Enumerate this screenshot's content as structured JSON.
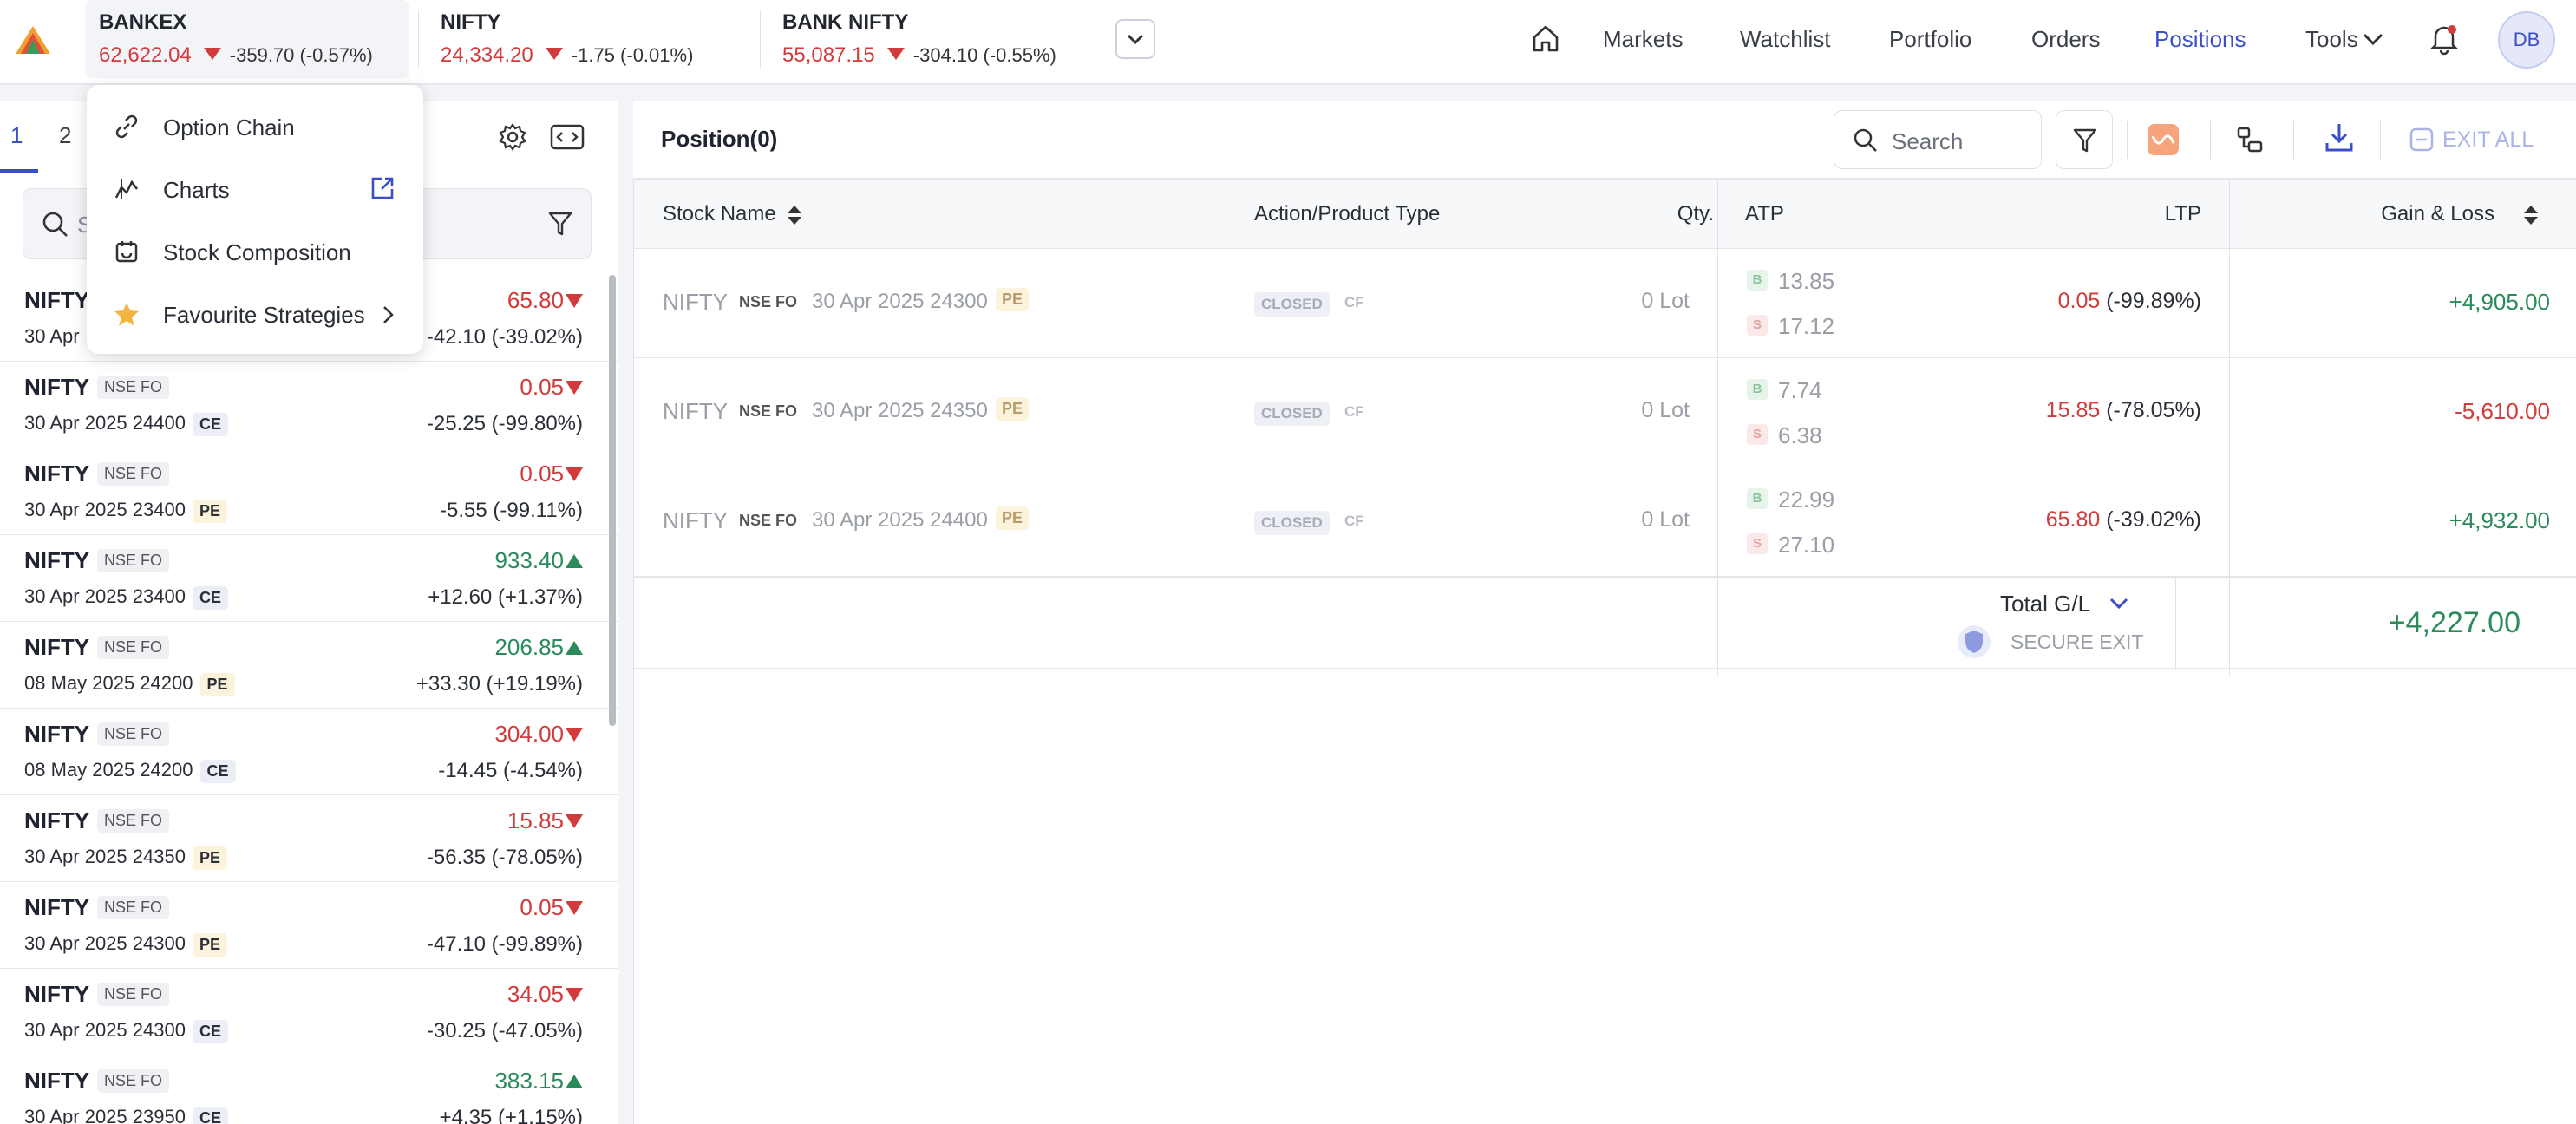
{
  "header": {
    "indices": [
      {
        "name": "BANKEX",
        "price": "62,622.04",
        "change": "-359.70 (-0.57%)"
      },
      {
        "name": "NIFTY",
        "price": "24,334.20",
        "change": "-1.75 (-0.01%)"
      },
      {
        "name": "BANK NIFTY",
        "price": "55,087.15",
        "change": "-304.10 (-0.55%)"
      }
    ],
    "nav": [
      "Markets",
      "Watchlist",
      "Portfolio",
      "Orders",
      "Positions",
      "Tools"
    ],
    "active_nav": "Positions",
    "avatar": "DB"
  },
  "watchlist": {
    "tabs": [
      "1",
      "2"
    ],
    "search_placeholder": "S",
    "rows": [
      {
        "symbol": "NIFTY",
        "exchange": "NSE FO",
        "desc": "30 Apr",
        "type": "",
        "ltp": "65.80",
        "dir": "down",
        "change": "-42.10 (-39.02%)"
      },
      {
        "symbol": "NIFTY",
        "exchange": "NSE FO",
        "desc": "30 Apr 2025 24400",
        "type": "CE",
        "ltp": "0.05",
        "dir": "down",
        "change": "-25.25 (-99.80%)"
      },
      {
        "symbol": "NIFTY",
        "exchange": "NSE FO",
        "desc": "30 Apr 2025 23400",
        "type": "PE",
        "ltp": "0.05",
        "dir": "down",
        "change": "-5.55 (-99.11%)"
      },
      {
        "symbol": "NIFTY",
        "exchange": "NSE FO",
        "desc": "30 Apr 2025 23400",
        "type": "CE",
        "ltp": "933.40",
        "dir": "up",
        "change": "+12.60 (+1.37%)"
      },
      {
        "symbol": "NIFTY",
        "exchange": "NSE FO",
        "desc": "08 May 2025 24200",
        "type": "PE",
        "ltp": "206.85",
        "dir": "up",
        "change": "+33.30 (+19.19%)"
      },
      {
        "symbol": "NIFTY",
        "exchange": "NSE FO",
        "desc": "08 May 2025 24200",
        "type": "CE",
        "ltp": "304.00",
        "dir": "down",
        "change": "-14.45 (-4.54%)"
      },
      {
        "symbol": "NIFTY",
        "exchange": "NSE FO",
        "desc": "30 Apr 2025 24350",
        "type": "PE",
        "ltp": "15.85",
        "dir": "down",
        "change": "-56.35 (-78.05%)"
      },
      {
        "symbol": "NIFTY",
        "exchange": "NSE FO",
        "desc": "30 Apr 2025 24300",
        "type": "PE",
        "ltp": "0.05",
        "dir": "down",
        "change": "-47.10 (-99.89%)"
      },
      {
        "symbol": "NIFTY",
        "exchange": "NSE FO",
        "desc": "30 Apr 2025 24300",
        "type": "CE",
        "ltp": "34.05",
        "dir": "down",
        "change": "-30.25 (-47.05%)"
      },
      {
        "symbol": "NIFTY",
        "exchange": "NSE FO",
        "desc": "30 Apr 2025 23950",
        "type": "CE",
        "ltp": "383.15",
        "dir": "up",
        "change": "+4.35 (+1.15%)"
      }
    ]
  },
  "menu": {
    "items": [
      {
        "label": "Option Chain",
        "icon": "link-icon"
      },
      {
        "label": "Charts",
        "icon": "chart-icon"
      },
      {
        "label": "Stock Composition",
        "icon": "composition-icon"
      },
      {
        "label": "Favourite Strategies",
        "icon": "star-icon"
      }
    ]
  },
  "positions": {
    "title": "Position(0)",
    "search_placeholder": "Search",
    "exit_all": "EXIT ALL",
    "columns": [
      "Stock Name",
      "Action/Product Type",
      "Qty.",
      "ATP",
      "LTP",
      "Gain & Loss"
    ],
    "rows": [
      {
        "symbol": "NIFTY",
        "exchange": "NSE FO",
        "expiry": "30 Apr 2025 24300",
        "type": "PE",
        "status": "CLOSED",
        "product": "CF",
        "qty": "0 Lot",
        "buy": "13.85",
        "sell": "17.12",
        "ltp": "0.05",
        "ltp_change": "(-99.89%)",
        "gl": "+4,905.00",
        "gl_dir": "up"
      },
      {
        "symbol": "NIFTY",
        "exchange": "NSE FO",
        "expiry": "30 Apr 2025 24350",
        "type": "PE",
        "status": "CLOSED",
        "product": "CF",
        "qty": "0 Lot",
        "buy": "7.74",
        "sell": "6.38",
        "ltp": "15.85",
        "ltp_change": "(-78.05%)",
        "gl": "-5,610.00",
        "gl_dir": "down"
      },
      {
        "symbol": "NIFTY",
        "exchange": "NSE FO",
        "expiry": "30 Apr 2025 24400",
        "type": "PE",
        "status": "CLOSED",
        "product": "CF",
        "qty": "0 Lot",
        "buy": "22.99",
        "sell": "27.10",
        "ltp": "65.80",
        "ltp_change": "(-39.02%)",
        "gl": "+4,932.00",
        "gl_dir": "up"
      }
    ],
    "total_label": "Total G/L",
    "secure_exit": "SECURE EXIT",
    "total_value": "+4,227.00"
  },
  "colors": {
    "accent": "#3a4fc7",
    "up": "#2a8a5a",
    "down": "#d23b3b"
  }
}
